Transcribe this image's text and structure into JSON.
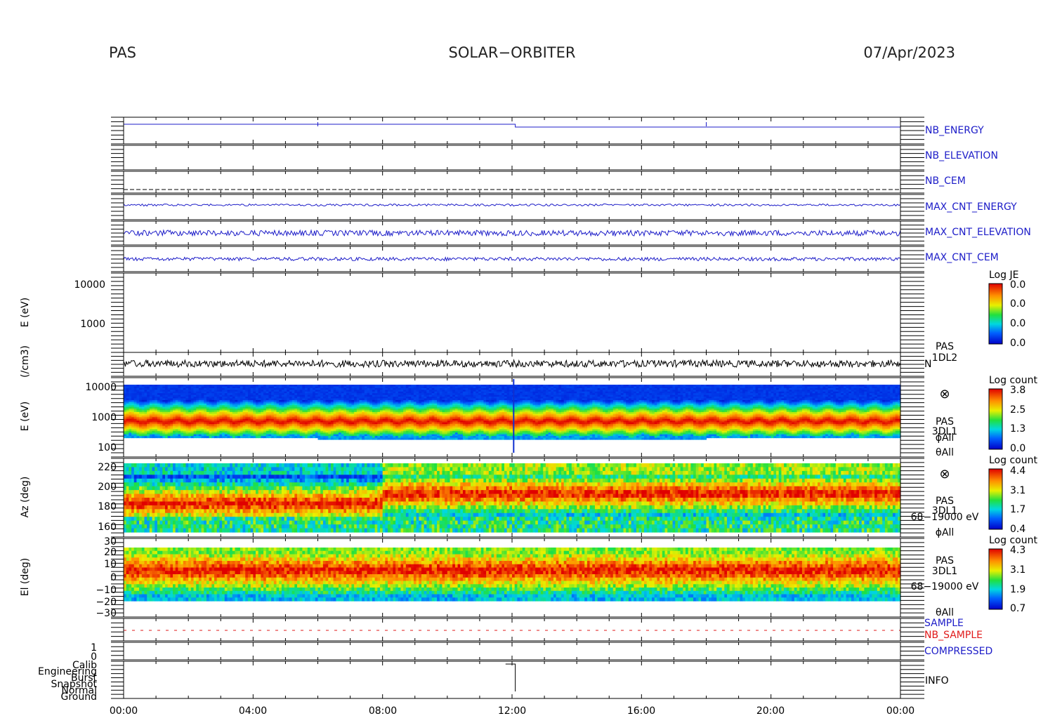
{
  "header": {
    "left": "PAS",
    "center": "SOLAR−ORBITER",
    "right": "07/Apr/2023"
  },
  "colors": {
    "line_blue": "#1c1cc8",
    "nb_sample_red": "#e01a1a",
    "axis": "#000000"
  },
  "x_axis": {
    "ticks": [
      "00:00",
      "04:00",
      "08:00",
      "12:00",
      "16:00",
      "20:00",
      "00:00"
    ]
  },
  "panels": {
    "nb_energy": {
      "label": "NB_ENERGY"
    },
    "nb_elevation": {
      "label": "NB_ELEVATION"
    },
    "nb_cem": {
      "label": "NB_CEM"
    },
    "max_cnt_energy": {
      "label": "MAX_CNT_ENERGY"
    },
    "max_cnt_elevation": {
      "label": "MAX_CNT_ELEVATION"
    },
    "max_cnt_cem": {
      "label": "MAX_CNT_CEM"
    },
    "je": {
      "ylabel": "E (eV)",
      "ticks": [
        "10000",
        "1000"
      ],
      "cbar_title": "Log JE",
      "cbar_ticks": [
        "0.0",
        "0.0",
        "0.0",
        "0.0"
      ]
    },
    "density": {
      "ylabel": "(/cm3)",
      "side_top": "PAS",
      "side_mid": "1DL2",
      "side_n": "N"
    },
    "energy_spec": {
      "ylabel": "E (eV)",
      "ticks": [
        "10000",
        "1000",
        "100"
      ],
      "cbar_title": "Log count",
      "cbar_ticks": [
        "3.8",
        "2.5",
        "1.3",
        "0.0"
      ],
      "side_symbol": "⊗",
      "side_pas": "PAS",
      "side_3dl1": "3DL1",
      "side_phi": "ϕAll",
      "side_theta": "θAll"
    },
    "az_spec": {
      "ylabel": "Az (deg)",
      "ticks": [
        "220",
        "200",
        "180",
        "160"
      ],
      "cbar_title": "Log count",
      "cbar_ticks": [
        "4.4",
        "3.1",
        "1.7",
        "0.4"
      ],
      "side_symbol": "⊗",
      "side_pas": "PAS",
      "side_3dl1": "3DL1",
      "side_range": "68−19000 eV",
      "side_phi": "ϕAll"
    },
    "el_spec": {
      "ylabel": "El (deg)",
      "ticks": [
        "30",
        "20",
        "10",
        "0",
        "−10",
        "−20",
        "−30"
      ],
      "cbar_title": "Log count",
      "cbar_ticks": [
        "4.3",
        "3.1",
        "1.9",
        "0.7"
      ],
      "side_pas": "PAS",
      "side_3dl1": "3DL1",
      "side_range": "68−19000 eV",
      "side_theta": "θAll"
    },
    "sample": {
      "label": "SAMPLE",
      "label2": "NB_SAMPLE"
    },
    "compressed": {
      "label": "COMPRESSED",
      "ticks": [
        "1",
        "0"
      ]
    },
    "info": {
      "label": "INFO",
      "ticks": [
        "Calib",
        "Engineering",
        "Burst",
        "Snapshot",
        "Normal",
        "Ground"
      ]
    }
  },
  "chart_data": {
    "type": "heatmap",
    "x_range_hours": [
      0,
      24
    ],
    "grid": false,
    "energy_spectrogram": {
      "ylim_eV": [
        100,
        10000
      ],
      "log_y": true,
      "colorbar": [
        0.0,
        3.8
      ],
      "peak_energy_eV": 800
    },
    "azimuth_spectrogram": {
      "ylim_deg": [
        155,
        225
      ],
      "colorbar": [
        0.4,
        4.4
      ],
      "peak_az_deg_before_8h": 183,
      "peak_az_deg_after_8h": 193
    },
    "elevation_spectrogram": {
      "ylim_deg": [
        -30,
        30
      ],
      "colorbar": [
        0.7,
        4.3
      ],
      "peak_el_deg": 5
    },
    "info_mode_step_hour": 12.1
  }
}
